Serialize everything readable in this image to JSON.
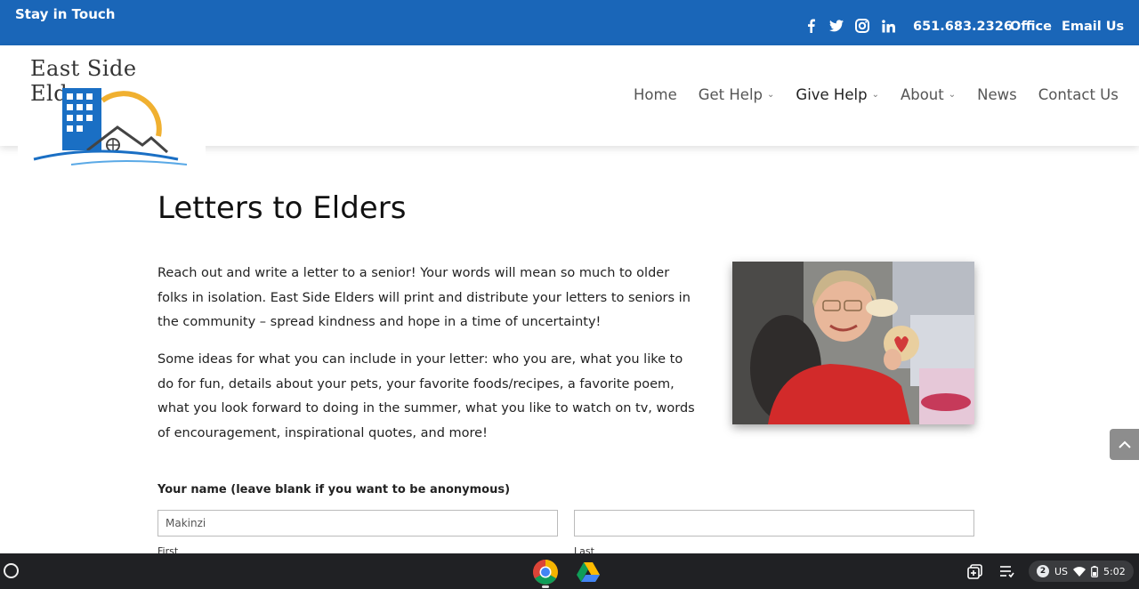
{
  "topbar": {
    "stay_in_touch": "Stay in Touch",
    "social": [
      "facebook-icon",
      "twitter-icon",
      "instagram-icon",
      "linkedin-icon"
    ],
    "phone": "651.683.2326",
    "office": "Office",
    "email": "Email Us",
    "bg_color": "#1a66b8"
  },
  "logo": {
    "text": "East Side Elders"
  },
  "nav": {
    "home": "Home",
    "get_help": "Get Help",
    "give_help": "Give Help",
    "about": "About",
    "news": "News",
    "contact": "Contact Us"
  },
  "main": {
    "title": "Letters to Elders",
    "paragraph1": "Reach out and write a letter to a senior!  Your words will mean so much to older folks in isolation.  East Side Elders will print and distribute your letters to seniors in the community – spread kindness and hope in a time of uncertainty!",
    "paragraph2": "Some ideas for what you can include in your letter:  who you are, what you like to do for fun, details about your pets, your favorite foods/recipes, a favorite poem, what you look forward to doing in the summer, what you like to watch on tv, words of encouragement, inspirational quotes, and more!"
  },
  "form": {
    "name_label": "Your name (leave blank if you want to be anonymous)",
    "first_value": "Makinzi",
    "last_value": "",
    "first_sublabel": "First",
    "last_sublabel": "Last"
  },
  "taskbar": {
    "notification_count": "2",
    "locale": "US",
    "time": "5:02"
  }
}
